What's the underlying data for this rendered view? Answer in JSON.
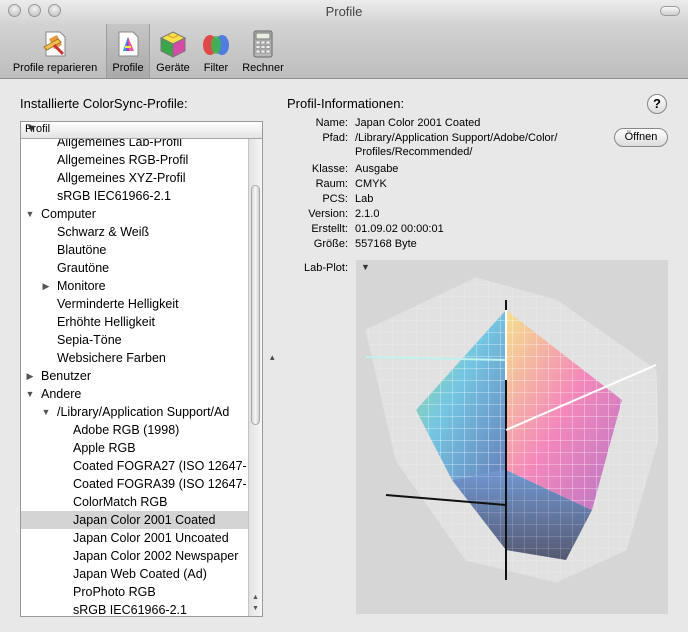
{
  "window": {
    "title": "Profile"
  },
  "toolbar": {
    "items": [
      {
        "label": "Profile reparieren",
        "icon": "repair-profile-icon"
      },
      {
        "label": "Profile",
        "icon": "profile-icon"
      },
      {
        "label": "Geräte",
        "icon": "devices-icon"
      },
      {
        "label": "Filter",
        "icon": "filter-icon"
      },
      {
        "label": "Rechner",
        "icon": "calculator-icon"
      }
    ],
    "selected": "Profile"
  },
  "left": {
    "heading": "Installierte ColorSync-Profile:",
    "column_header": "Profil",
    "rows": [
      {
        "label": "Allgemeines Lab-Profil",
        "level": 2,
        "type": "leaf"
      },
      {
        "label": "Allgemeines RGB-Profil",
        "level": 2,
        "type": "leaf"
      },
      {
        "label": "Allgemeines XYZ-Profil",
        "level": 2,
        "type": "leaf"
      },
      {
        "label": "sRGB IEC61966-2.1",
        "level": 2,
        "type": "leaf"
      },
      {
        "label": "Computer",
        "level": 1,
        "type": "expanded"
      },
      {
        "label": "Schwarz & Weiß",
        "level": 2,
        "type": "leaf"
      },
      {
        "label": "Blautöne",
        "level": 2,
        "type": "leaf"
      },
      {
        "label": "Grautöne",
        "level": 2,
        "type": "leaf"
      },
      {
        "label": "Monitore",
        "level": 2,
        "type": "collapsed"
      },
      {
        "label": "Verminderte Helligkeit",
        "level": 2,
        "type": "leaf"
      },
      {
        "label": "Erhöhte Helligkeit",
        "level": 2,
        "type": "leaf"
      },
      {
        "label": "Sepia-Töne",
        "level": 2,
        "type": "leaf"
      },
      {
        "label": "Websichere Farben",
        "level": 2,
        "type": "leaf"
      },
      {
        "label": "Benutzer",
        "level": 1,
        "type": "collapsed"
      },
      {
        "label": "Andere",
        "level": 1,
        "type": "expanded"
      },
      {
        "label": "/Library/Application Support/Ad",
        "level": 2,
        "type": "expanded"
      },
      {
        "label": "Adobe RGB (1998)",
        "level": 3,
        "type": "leaf"
      },
      {
        "label": "Apple RGB",
        "level": 3,
        "type": "leaf"
      },
      {
        "label": "Coated FOGRA27 (ISO 12647-",
        "level": 3,
        "type": "leaf"
      },
      {
        "label": "Coated FOGRA39 (ISO 12647-",
        "level": 3,
        "type": "leaf"
      },
      {
        "label": "ColorMatch RGB",
        "level": 3,
        "type": "leaf"
      },
      {
        "label": "Japan Color 2001 Coated",
        "level": 3,
        "type": "leaf",
        "selected": true
      },
      {
        "label": "Japan Color 2001 Uncoated",
        "level": 3,
        "type": "leaf"
      },
      {
        "label": "Japan Color 2002 Newspaper",
        "level": 3,
        "type": "leaf"
      },
      {
        "label": "Japan Web Coated (Ad)",
        "level": 3,
        "type": "leaf"
      },
      {
        "label": "ProPhoto RGB",
        "level": 3,
        "type": "leaf"
      },
      {
        "label": "sRGB IEC61966-2.1",
        "level": 3,
        "type": "leaf"
      }
    ]
  },
  "right": {
    "heading": "Profil-Informationen:",
    "help_label": "?",
    "open_button": "Öffnen",
    "fields": [
      {
        "label": "Name:",
        "value": "Japan Color 2001 Coated"
      },
      {
        "label": "Pfad:",
        "value": "/Library/Application Support/Adobe/Color/",
        "value2": "Profiles/Recommended/"
      },
      {
        "label": "Klasse:",
        "value": "Ausgabe"
      },
      {
        "label": "Raum:",
        "value": "CMYK"
      },
      {
        "label": "PCS:",
        "value": "Lab"
      },
      {
        "label": "Version:",
        "value": "2.1.0"
      },
      {
        "label": "Erstellt:",
        "value": "01.09.02 00:00:01"
      },
      {
        "label": "Größe:",
        "value": "557168 Byte"
      }
    ],
    "lab_plot_label": "Lab-Plot:"
  }
}
